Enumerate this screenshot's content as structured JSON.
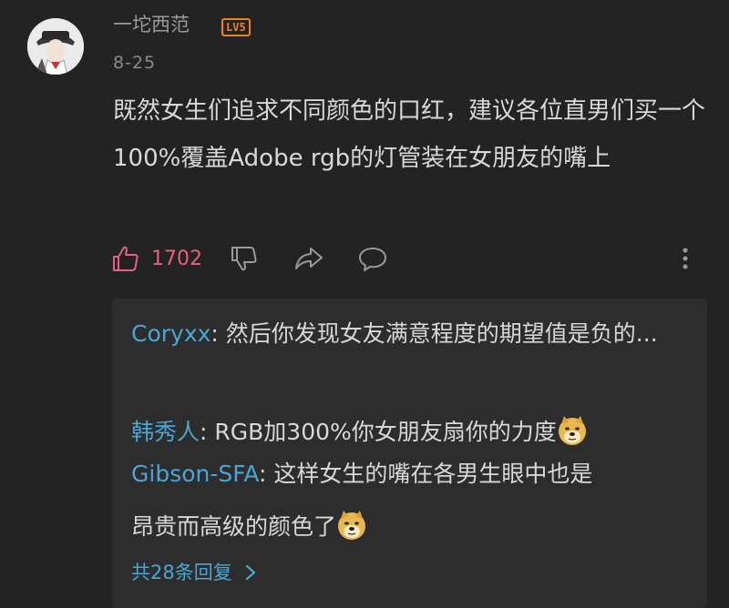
{
  "comment": {
    "username": "一坨西范",
    "level": "LV5",
    "date": "8-25",
    "text": "既然女生们追求不同颜色的口红，建议各位直男们买一个100%覆盖Adobe rgb的灯管装在女朋友的嘴上"
  },
  "actions": {
    "like_count": "1702"
  },
  "replies": [
    {
      "name": "Coryxx",
      "separator": ": ",
      "text": "然后你发现女友满意程度的期望值是负的..."
    },
    {
      "name": "韩秀人",
      "separator": ": ",
      "text": "RGB加300%你女朋友扇你的力度",
      "emoji": "doge-emoji"
    },
    {
      "name": "Gibson-SFA",
      "separator": ": ",
      "text": "这样女生的嘴在各男生眼中也是"
    }
  ],
  "reply_continuation": {
    "text": "昂贵而高级的颜色了",
    "emoji": "doge-emoji"
  },
  "more_replies_label": "共28条回复",
  "colors": {
    "background": "#232323",
    "reply_box": "#2d2d2d",
    "like_accent": "#e6617d",
    "name_blue": "#4aa6d6",
    "badge_orange": "#f0821e"
  }
}
